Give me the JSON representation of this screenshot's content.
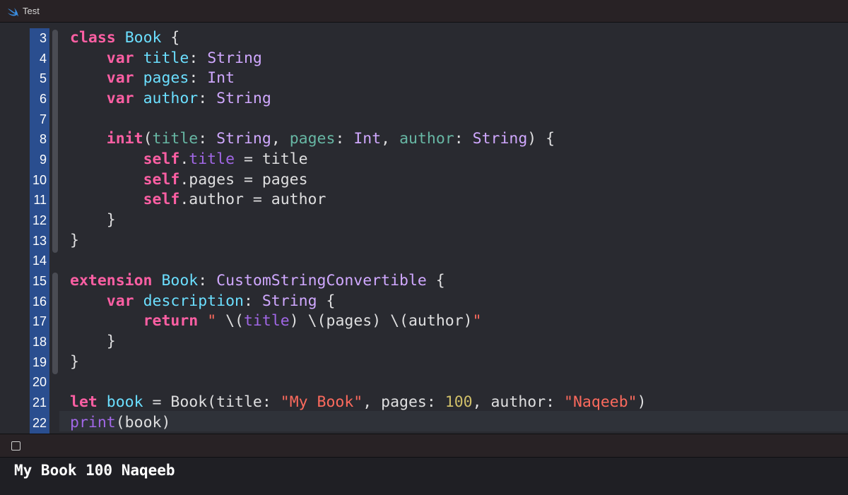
{
  "window": {
    "title": "Test",
    "icon": "swift-icon"
  },
  "editor": {
    "lines": [
      {
        "n": "3",
        "tokens": [
          {
            "t": "class",
            "c": "kw"
          },
          {
            "t": " "
          },
          {
            "t": "Book",
            "c": "decl"
          },
          {
            "t": " {"
          }
        ]
      },
      {
        "n": "4",
        "tokens": [
          {
            "t": "    "
          },
          {
            "t": "var",
            "c": "kw"
          },
          {
            "t": " "
          },
          {
            "t": "title",
            "c": "decl"
          },
          {
            "t": ": "
          },
          {
            "t": "String",
            "c": "type"
          }
        ]
      },
      {
        "n": "5",
        "tokens": [
          {
            "t": "    "
          },
          {
            "t": "var",
            "c": "kw"
          },
          {
            "t": " "
          },
          {
            "t": "pages",
            "c": "decl"
          },
          {
            "t": ": "
          },
          {
            "t": "Int",
            "c": "type"
          }
        ]
      },
      {
        "n": "6",
        "tokens": [
          {
            "t": "    "
          },
          {
            "t": "var",
            "c": "kw"
          },
          {
            "t": " "
          },
          {
            "t": "author",
            "c": "decl"
          },
          {
            "t": ": "
          },
          {
            "t": "String",
            "c": "type"
          }
        ]
      },
      {
        "n": "7",
        "tokens": [
          {
            "t": ""
          }
        ]
      },
      {
        "n": "8",
        "tokens": [
          {
            "t": "    "
          },
          {
            "t": "init",
            "c": "kw"
          },
          {
            "t": "("
          },
          {
            "t": "title",
            "c": "param"
          },
          {
            "t": ": "
          },
          {
            "t": "String",
            "c": "type"
          },
          {
            "t": ", "
          },
          {
            "t": "pages",
            "c": "param"
          },
          {
            "t": ": "
          },
          {
            "t": "Int",
            "c": "type"
          },
          {
            "t": ", "
          },
          {
            "t": "author",
            "c": "param"
          },
          {
            "t": ": "
          },
          {
            "t": "String",
            "c": "type"
          },
          {
            "t": ") {"
          }
        ]
      },
      {
        "n": "9",
        "tokens": [
          {
            "t": "        "
          },
          {
            "t": "self",
            "c": "kw"
          },
          {
            "t": "."
          },
          {
            "t": "title",
            "c": "prop"
          },
          {
            "t": " = title"
          }
        ]
      },
      {
        "n": "10",
        "tokens": [
          {
            "t": "        "
          },
          {
            "t": "self",
            "c": "kw"
          },
          {
            "t": ".pages = pages"
          }
        ]
      },
      {
        "n": "11",
        "tokens": [
          {
            "t": "        "
          },
          {
            "t": "self",
            "c": "kw"
          },
          {
            "t": ".author = author"
          }
        ]
      },
      {
        "n": "12",
        "tokens": [
          {
            "t": "    }"
          }
        ]
      },
      {
        "n": "13",
        "tokens": [
          {
            "t": "}"
          }
        ]
      },
      {
        "n": "14",
        "tokens": [
          {
            "t": ""
          }
        ]
      },
      {
        "n": "15",
        "tokens": [
          {
            "t": "extension",
            "c": "kw"
          },
          {
            "t": " "
          },
          {
            "t": "Book",
            "c": "decl"
          },
          {
            "t": ": "
          },
          {
            "t": "CustomStringConvertible",
            "c": "type"
          },
          {
            "t": " {"
          }
        ]
      },
      {
        "n": "16",
        "tokens": [
          {
            "t": "    "
          },
          {
            "t": "var",
            "c": "kw"
          },
          {
            "t": " "
          },
          {
            "t": "description",
            "c": "decl"
          },
          {
            "t": ": "
          },
          {
            "t": "String",
            "c": "type"
          },
          {
            "t": " {"
          }
        ]
      },
      {
        "n": "17",
        "tokens": [
          {
            "t": "        "
          },
          {
            "t": "return",
            "c": "kw"
          },
          {
            "t": " "
          },
          {
            "t": "\"",
            "c": "str"
          },
          {
            "t": " \\("
          },
          {
            "t": "title",
            "c": "prop"
          },
          {
            "t": ") \\(pages) \\(author)"
          },
          {
            "t": "\"",
            "c": "str"
          }
        ]
      },
      {
        "n": "18",
        "tokens": [
          {
            "t": "    }"
          }
        ]
      },
      {
        "n": "19",
        "tokens": [
          {
            "t": "}"
          }
        ]
      },
      {
        "n": "20",
        "tokens": [
          {
            "t": ""
          }
        ]
      },
      {
        "n": "21",
        "tokens": [
          {
            "t": "let",
            "c": "kw"
          },
          {
            "t": " "
          },
          {
            "t": "book",
            "c": "decl"
          },
          {
            "t": " = Book(title: "
          },
          {
            "t": "\"My Book\"",
            "c": "str"
          },
          {
            "t": ", pages: "
          },
          {
            "t": "100",
            "c": "num"
          },
          {
            "t": ", author: "
          },
          {
            "t": "\"Naqeeb\"",
            "c": "str"
          },
          {
            "t": ")"
          }
        ]
      },
      {
        "n": "22",
        "tokens": [
          {
            "t": "print",
            "c": "func"
          },
          {
            "t": "(book)"
          }
        ]
      }
    ]
  },
  "console": {
    "output": "My Book 100 Naqeeb"
  },
  "colors": {
    "keyword": "#fc5fa3",
    "type": "#d0a8ff",
    "declaration": "#6bdfff",
    "string": "#fc6a5d",
    "number": "#d0bf69",
    "selection_gutter": "#2a4e8f"
  }
}
